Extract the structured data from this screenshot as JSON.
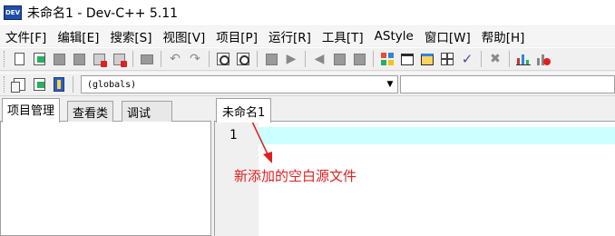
{
  "window": {
    "title": "未命名1 - Dev-C++ 5.11",
    "icon_label": "DEV"
  },
  "menu": {
    "items": [
      "文件[F]",
      "编辑[E]",
      "搜索[S]",
      "视图[V]",
      "项目[P]",
      "运行[R]",
      "工具[T]",
      "AStyle",
      "窗口[W]",
      "帮助[H]"
    ]
  },
  "toolbar": {
    "row1_icons": [
      "new-file-icon",
      "open-file-icon",
      "save-icon",
      "save-all-icon",
      "close-icon",
      "close-all-icon",
      "print-icon",
      "undo-icon",
      "redo-icon",
      "find-icon",
      "replace-icon",
      "indent-icon",
      "unindent-icon",
      "bookmark-icon",
      "goto-icon",
      "toggle-comment-icon",
      "compile-icon",
      "run-icon",
      "compile-run-icon",
      "rebuild-icon",
      "syntax-check-icon",
      "stop-icon",
      "chart-icon",
      "profile-delete-icon"
    ],
    "row2_icons": [
      "new-project-icon",
      "add-to-project-icon",
      "project-options-icon"
    ],
    "scope_combo": "(globals)",
    "symbol_combo": ""
  },
  "left_panel": {
    "tabs": [
      "项目管理",
      "查看类",
      "调试"
    ],
    "active_tab": "项目管理"
  },
  "editor": {
    "tab_label": "未命名1",
    "line_numbers": [
      "1"
    ],
    "active_line_color": "#ccffff"
  },
  "annotation": {
    "text": "新添加的空白源文件",
    "color": "#e02020"
  }
}
